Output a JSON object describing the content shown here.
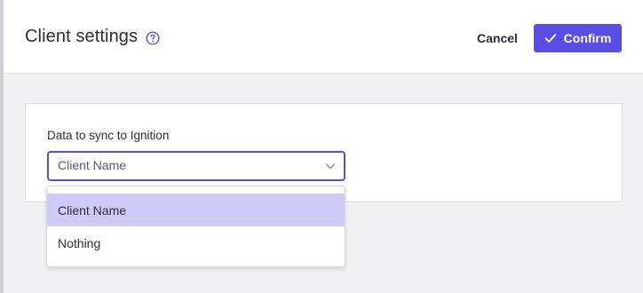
{
  "header": {
    "title": "Client settings",
    "help_icon": "help-circle-icon",
    "cancel_label": "Cancel",
    "confirm_label": "Confirm",
    "confirm_icon": "check-icon"
  },
  "form": {
    "field_label": "Data to sync to Ignition",
    "selected_value": "Client Name",
    "options": [
      {
        "label": "Client Name",
        "selected": true
      },
      {
        "label": "Nothing",
        "selected": false
      }
    ]
  },
  "colors": {
    "accent": "#5a4de6",
    "selected_option_bg": "#cfcaf6",
    "backdrop": "#f1f1f3"
  }
}
